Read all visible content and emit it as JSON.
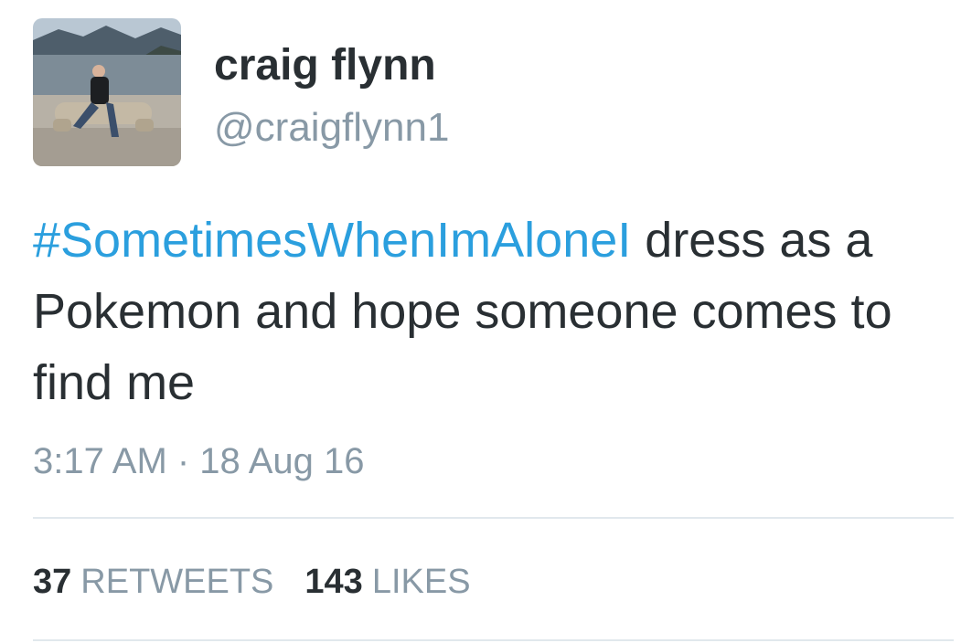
{
  "user": {
    "display_name": "craig flynn",
    "handle": "@craigflynn1",
    "avatar_icon": "profile-photo-person-on-log-by-lake"
  },
  "tweet": {
    "hashtag": "#SometimesWhenImAloneI",
    "text_rest": " dress as a Pokemon and hope someone comes to find me",
    "timestamp": "3:17 AM · 18 Aug 16"
  },
  "stats": {
    "retweets_count": "37",
    "retweets_label": "RETWEETS",
    "likes_count": "143",
    "likes_label": "LIKES"
  },
  "colors": {
    "hashtag": "#2b9fde",
    "text": "#292f33",
    "muted": "#8899a6",
    "divider": "#e1e8ed"
  }
}
